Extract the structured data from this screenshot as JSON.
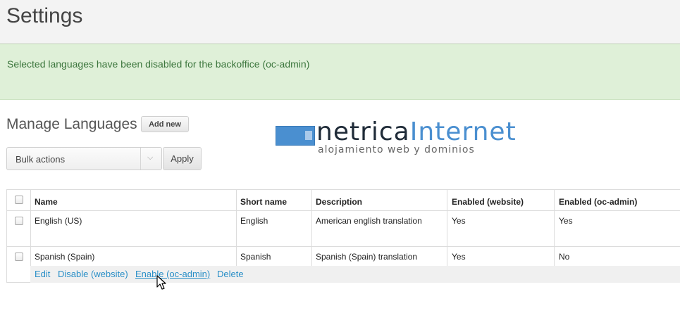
{
  "header": {
    "title": "Settings"
  },
  "flash": {
    "message": "Selected languages have been disabled for the backoffice (oc-admin)"
  },
  "section": {
    "title": "Manage Languages",
    "add_new_label": "Add new"
  },
  "logo": {
    "word1": "netrica",
    "word2": "Internet",
    "tagline": "alojamiento web y dominios",
    "accent_color": "#4a8fd0"
  },
  "bulk": {
    "selected": "Bulk actions",
    "apply_label": "Apply"
  },
  "table": {
    "columns": [
      "Name",
      "Short name",
      "Description",
      "Enabled (website)",
      "Enabled (oc-admin)"
    ],
    "rows": [
      {
        "name": "English (US)",
        "short_name": "English",
        "description": "American english translation",
        "enabled_website": "Yes",
        "enabled_admin": "Yes"
      },
      {
        "name": "Spanish (Spain)",
        "short_name": "Spanish",
        "description": "Spanish (Spain) translation",
        "enabled_website": "Yes",
        "enabled_admin": "No"
      }
    ],
    "row_actions": [
      "Edit",
      "Disable (website)",
      "Enable (oc-admin)",
      "Delete"
    ]
  }
}
